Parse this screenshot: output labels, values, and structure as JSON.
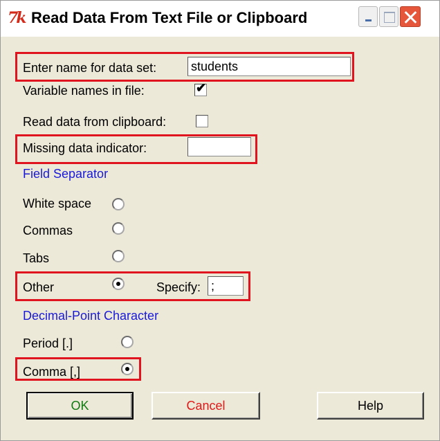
{
  "window": {
    "title": "Read Data From Text File or Clipboard",
    "app_icon": "tk-feather-icon"
  },
  "form": {
    "dataset_name_label": "Enter name for data set:",
    "dataset_name_value": "students",
    "variable_names_label": "Variable names in file:",
    "variable_names_checked": true,
    "clipboard_label": "Read data from clipboard:",
    "clipboard_checked": false,
    "missing_label": "Missing data indicator:",
    "missing_value": ""
  },
  "field_separator": {
    "heading": "Field Separator",
    "options": [
      {
        "label": "White space",
        "selected": false
      },
      {
        "label": "Commas",
        "selected": false
      },
      {
        "label": "Tabs",
        "selected": false
      },
      {
        "label": "Other",
        "selected": true
      }
    ],
    "specify_label": "Specify:",
    "specify_value": ";"
  },
  "decimal": {
    "heading": "Decimal-Point Character",
    "options": [
      {
        "label": "Period [.]",
        "selected": false
      },
      {
        "label": "Comma [,]",
        "selected": true
      }
    ]
  },
  "buttons": {
    "ok": "OK",
    "cancel": "Cancel",
    "help": "Help"
  },
  "colors": {
    "highlight": "#e0141e",
    "heading_blue": "#1a1ad8",
    "ok_text": "#0f7a0f",
    "cancel_text": "#e01818"
  },
  "checkmark": "✔"
}
